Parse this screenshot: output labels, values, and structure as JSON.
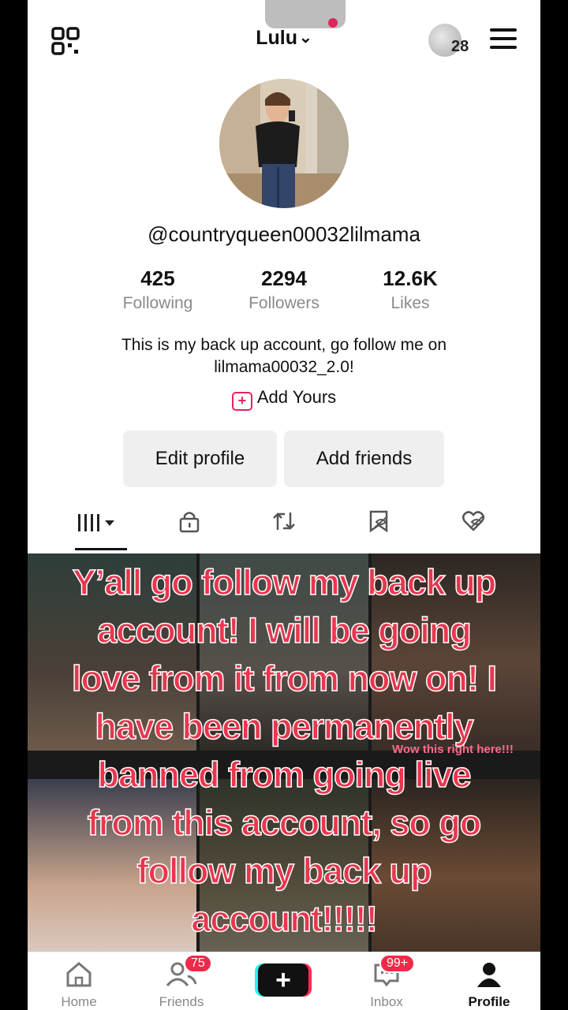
{
  "header": {
    "username": "Lulu",
    "notification_count": "28",
    "icons": [
      "qr-code-icon",
      "chevron-down-icon",
      "menu-icon"
    ]
  },
  "profile": {
    "handle": "@countryqueen00032lilmama",
    "stats": [
      {
        "value": "425",
        "label": "Following"
      },
      {
        "value": "2294",
        "label": "Followers"
      },
      {
        "value": "12.6K",
        "label": "Likes"
      }
    ],
    "bio_line1": "This is my back up account, go follow me on",
    "bio_line2": "lilmama00032_2.0!",
    "add_yours": "Add Yours",
    "edit_profile": "Edit profile",
    "add_friends": "Add friends"
  },
  "tabs": [
    "videos-grid-icon",
    "lock-icon",
    "repost-icon",
    "bookmark-icon",
    "liked-icon"
  ],
  "overlay": {
    "line1": "Y’all go follow my back up",
    "line2": "account! I will be going",
    "line3": "love from it from now on! I",
    "line4": "have been permanently",
    "line5": "banned from going live",
    "line6": "from this account, so go",
    "line7": "follow my back up",
    "line8": "account!!!!!"
  },
  "grid_caption": "Wow this right here!!!",
  "nav": {
    "home": "Home",
    "friends": "Friends",
    "friends_badge": "75",
    "inbox": "Inbox",
    "inbox_badge": "99+",
    "profile": "Profile",
    "plus": "+"
  },
  "colors": {
    "accent": "#e0245e",
    "overlay_text": "#e8364e",
    "badge": "#f0294b"
  }
}
